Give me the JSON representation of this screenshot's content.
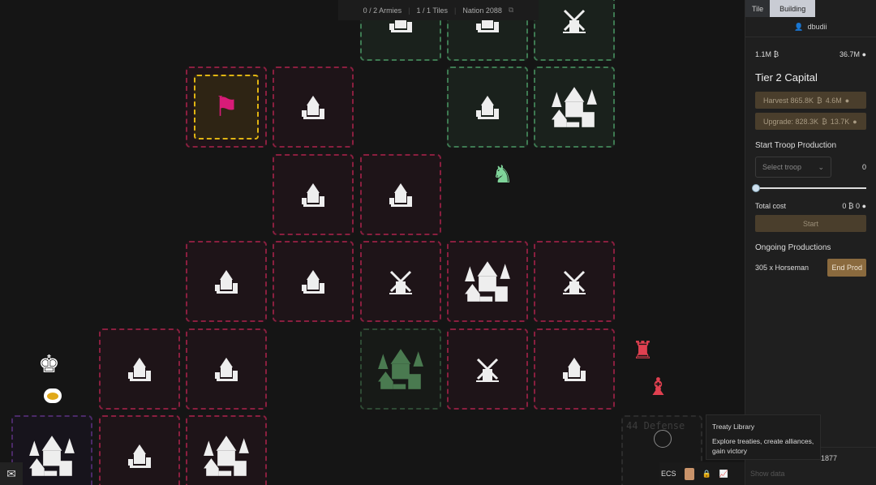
{
  "topbar": {
    "armies": "0 / 2 Armies",
    "tiles": "1 / 1 Tiles",
    "nation": "Nation 2088",
    "copy_icon": "copy-icon"
  },
  "panel": {
    "tabs": [
      {
        "label": "Tile"
      },
      {
        "label": "Building",
        "active": true
      }
    ],
    "user": "dbudii",
    "resources": {
      "gold": "1.1M",
      "food": "36.7M"
    },
    "title": "Tier 2 Capital",
    "harvest": {
      "label": "Harvest 865.8K",
      "food": "4.6M"
    },
    "upgrade": {
      "label": "Upgrade: 828.3K",
      "food": "13.7K"
    },
    "troop_production": {
      "heading": "Start Troop Production",
      "select_placeholder": "Select troop",
      "count": "0",
      "slider_value": 0,
      "total_label": "Total cost",
      "total_gold": "0",
      "total_food": "0",
      "start_label": "Start"
    },
    "ongoing": {
      "heading": "Ongoing Productions",
      "item": "305 x Horseman",
      "end_label": "End Prod"
    }
  },
  "tooltip": {
    "title": "Treaty Library",
    "body": "Explore treaties, create alliances, gain victory"
  },
  "bottombar": {
    "ecs": "ECS",
    "show_data": "Show data",
    "object_id": "1877"
  },
  "map": {
    "defense_label": "44 Defense",
    "colors": {
      "enemy": "#8a1f3f",
      "ally": "#3e7a52",
      "selected": "#e0b412",
      "own": "#4b2a68"
    }
  }
}
